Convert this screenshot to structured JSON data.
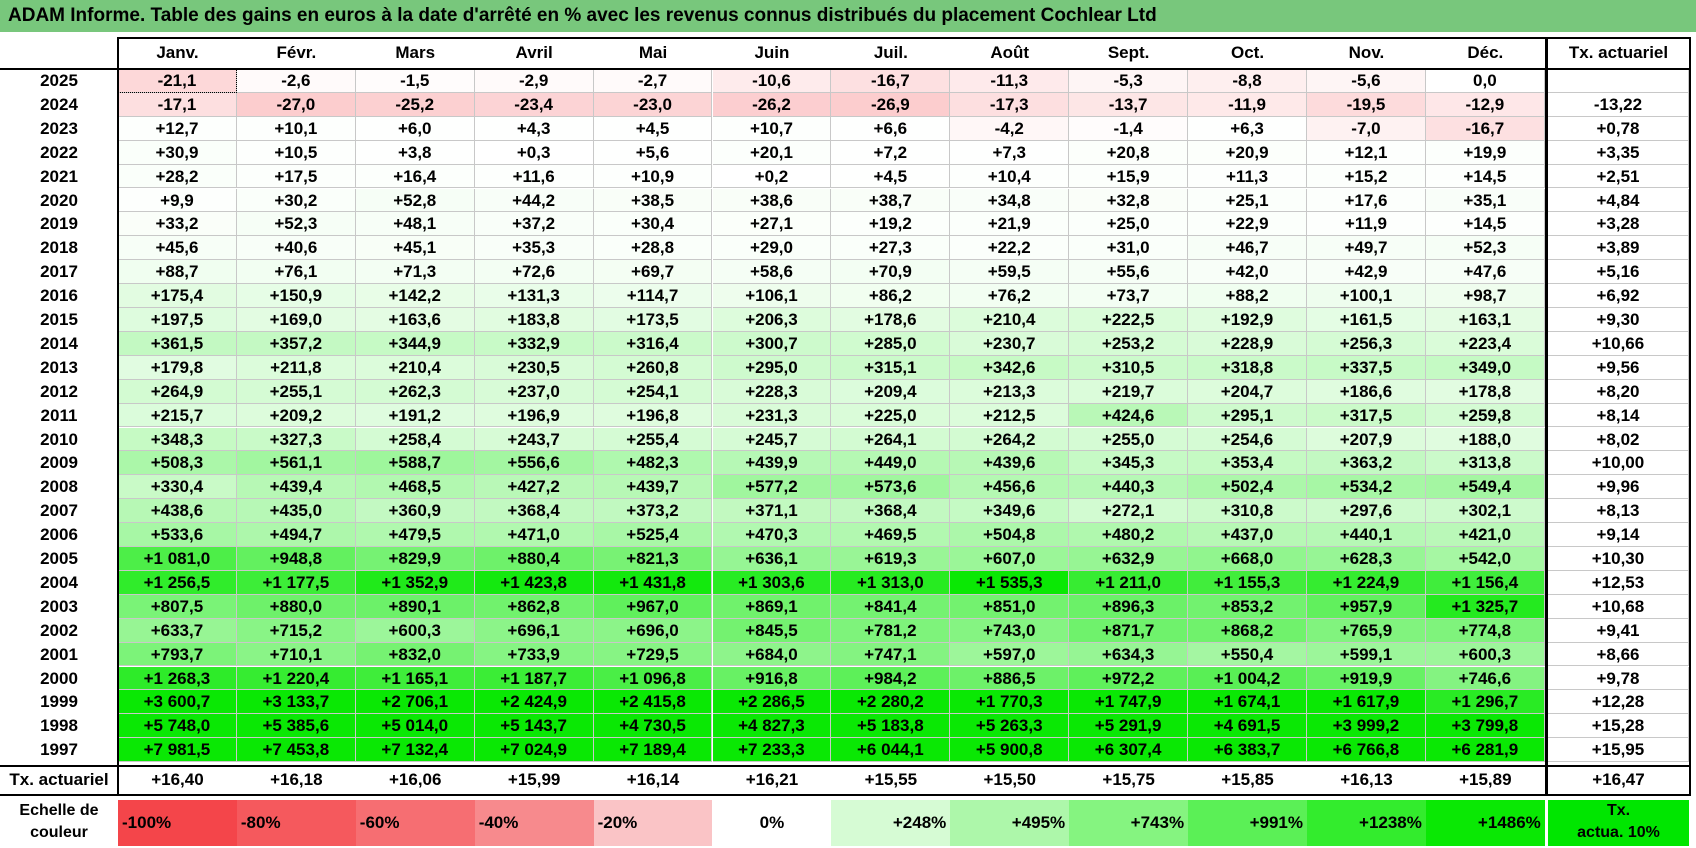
{
  "title": "ADAM Informe. Table des gains en euros à la date d'arrêté en % avec les revenus connus distribués du placement Cochlear Ltd",
  "months": [
    "Janv.",
    "Févr.",
    "Mars",
    "Avril",
    "Mai",
    "Juin",
    "Juil.",
    "Août",
    "Sept.",
    "Oct.",
    "Nov.",
    "Déc."
  ],
  "rate_header": "Tx. actuariel",
  "rows": [
    {
      "year": "2025",
      "values": [
        "-21,1",
        "-2,6",
        "-1,5",
        "-2,9",
        "-2,7",
        "-10,6",
        "-16,7",
        "-11,3",
        "-5,3",
        "-8,8",
        "-5,6",
        "0,0"
      ],
      "rate": ""
    },
    {
      "year": "2024",
      "values": [
        "-17,1",
        "-27,0",
        "-25,2",
        "-23,4",
        "-23,0",
        "-26,2",
        "-26,9",
        "-17,3",
        "-13,7",
        "-11,9",
        "-19,5",
        "-12,9"
      ],
      "rate": "-13,22"
    },
    {
      "year": "2023",
      "values": [
        "+12,7",
        "+10,1",
        "+6,0",
        "+4,3",
        "+4,5",
        "+10,7",
        "+6,6",
        "-4,2",
        "-1,4",
        "+6,3",
        "-7,0",
        "-16,7"
      ],
      "rate": "+0,78"
    },
    {
      "year": "2022",
      "values": [
        "+30,9",
        "+10,5",
        "+3,8",
        "+0,3",
        "+5,6",
        "+20,1",
        "+7,2",
        "+7,3",
        "+20,8",
        "+20,9",
        "+12,1",
        "+19,9"
      ],
      "rate": "+3,35"
    },
    {
      "year": "2021",
      "values": [
        "+28,2",
        "+17,5",
        "+16,4",
        "+11,6",
        "+10,9",
        "+0,2",
        "+4,5",
        "+10,4",
        "+15,9",
        "+11,3",
        "+15,2",
        "+14,5"
      ],
      "rate": "+2,51"
    },
    {
      "year": "2020",
      "values": [
        "+9,9",
        "+30,2",
        "+52,8",
        "+44,2",
        "+38,5",
        "+38,6",
        "+38,7",
        "+34,8",
        "+32,8",
        "+25,1",
        "+17,6",
        "+35,1"
      ],
      "rate": "+4,84"
    },
    {
      "year": "2019",
      "values": [
        "+33,2",
        "+52,3",
        "+48,1",
        "+37,2",
        "+30,4",
        "+27,1",
        "+19,2",
        "+21,9",
        "+25,0",
        "+22,9",
        "+11,9",
        "+14,5"
      ],
      "rate": "+3,28"
    },
    {
      "year": "2018",
      "values": [
        "+45,6",
        "+40,6",
        "+45,1",
        "+35,3",
        "+28,8",
        "+29,0",
        "+27,3",
        "+22,2",
        "+31,0",
        "+46,7",
        "+49,7",
        "+52,3"
      ],
      "rate": "+3,89"
    },
    {
      "year": "2017",
      "values": [
        "+88,7",
        "+76,1",
        "+71,3",
        "+72,6",
        "+69,7",
        "+58,6",
        "+70,9",
        "+59,5",
        "+55,6",
        "+42,0",
        "+42,9",
        "+47,6"
      ],
      "rate": "+5,16"
    },
    {
      "year": "2016",
      "values": [
        "+175,4",
        "+150,9",
        "+142,2",
        "+131,3",
        "+114,7",
        "+106,1",
        "+86,2",
        "+76,2",
        "+73,7",
        "+88,2",
        "+100,1",
        "+98,7"
      ],
      "rate": "+6,92"
    },
    {
      "year": "2015",
      "values": [
        "+197,5",
        "+169,0",
        "+163,6",
        "+183,8",
        "+173,5",
        "+206,3",
        "+178,6",
        "+210,4",
        "+222,5",
        "+192,9",
        "+161,5",
        "+163,1"
      ],
      "rate": "+9,30"
    },
    {
      "year": "2014",
      "values": [
        "+361,5",
        "+357,2",
        "+344,9",
        "+332,9",
        "+316,4",
        "+300,7",
        "+285,0",
        "+230,7",
        "+253,2",
        "+228,9",
        "+256,3",
        "+223,4"
      ],
      "rate": "+10,66"
    },
    {
      "year": "2013",
      "values": [
        "+179,8",
        "+211,8",
        "+210,4",
        "+230,5",
        "+260,8",
        "+295,0",
        "+315,1",
        "+342,6",
        "+310,5",
        "+318,8",
        "+337,5",
        "+349,0"
      ],
      "rate": "+9,56"
    },
    {
      "year": "2012",
      "values": [
        "+264,9",
        "+255,1",
        "+262,3",
        "+237,0",
        "+254,1",
        "+228,3",
        "+209,4",
        "+213,3",
        "+219,7",
        "+204,7",
        "+186,6",
        "+178,8"
      ],
      "rate": "+8,20"
    },
    {
      "year": "2011",
      "values": [
        "+215,7",
        "+209,2",
        "+191,2",
        "+196,9",
        "+196,8",
        "+231,3",
        "+225,0",
        "+212,5",
        "+424,6",
        "+295,1",
        "+317,5",
        "+259,8"
      ],
      "rate": "+8,14"
    },
    {
      "year": "2010",
      "values": [
        "+348,3",
        "+327,3",
        "+258,4",
        "+243,7",
        "+255,4",
        "+245,7",
        "+264,1",
        "+264,2",
        "+255,0",
        "+254,6",
        "+207,9",
        "+188,0"
      ],
      "rate": "+8,02"
    },
    {
      "year": "2009",
      "values": [
        "+508,3",
        "+561,1",
        "+588,7",
        "+556,6",
        "+482,3",
        "+439,9",
        "+449,0",
        "+439,6",
        "+345,3",
        "+353,4",
        "+363,2",
        "+313,8"
      ],
      "rate": "+10,00"
    },
    {
      "year": "2008",
      "values": [
        "+330,4",
        "+439,4",
        "+468,5",
        "+427,2",
        "+439,7",
        "+577,2",
        "+573,6",
        "+456,6",
        "+440,3",
        "+502,4",
        "+534,2",
        "+549,4"
      ],
      "rate": "+9,96"
    },
    {
      "year": "2007",
      "values": [
        "+438,6",
        "+435,0",
        "+360,9",
        "+368,4",
        "+373,2",
        "+371,1",
        "+368,4",
        "+349,6",
        "+272,1",
        "+310,8",
        "+297,6",
        "+302,1"
      ],
      "rate": "+8,13"
    },
    {
      "year": "2006",
      "values": [
        "+533,6",
        "+494,7",
        "+479,5",
        "+471,0",
        "+525,4",
        "+470,3",
        "+469,5",
        "+504,8",
        "+480,2",
        "+437,0",
        "+440,1",
        "+421,0"
      ],
      "rate": "+9,14"
    },
    {
      "year": "2005",
      "values": [
        "+1 081,0",
        "+948,8",
        "+829,9",
        "+880,4",
        "+821,3",
        "+636,1",
        "+619,3",
        "+607,0",
        "+632,9",
        "+668,0",
        "+628,3",
        "+542,0"
      ],
      "rate": "+10,30"
    },
    {
      "year": "2004",
      "values": [
        "+1 256,5",
        "+1 177,5",
        "+1 352,9",
        "+1 423,8",
        "+1 431,8",
        "+1 303,6",
        "+1 313,0",
        "+1 535,3",
        "+1 211,0",
        "+1 155,3",
        "+1 224,9",
        "+1 156,4"
      ],
      "rate": "+12,53"
    },
    {
      "year": "2003",
      "values": [
        "+807,5",
        "+880,0",
        "+890,1",
        "+862,8",
        "+967,0",
        "+869,1",
        "+841,4",
        "+851,0",
        "+896,3",
        "+853,2",
        "+957,9",
        "+1 325,7"
      ],
      "rate": "+10,68"
    },
    {
      "year": "2002",
      "values": [
        "+633,7",
        "+715,2",
        "+600,3",
        "+696,1",
        "+696,0",
        "+845,5",
        "+781,2",
        "+743,0",
        "+871,7",
        "+868,2",
        "+765,9",
        "+774,8"
      ],
      "rate": "+9,41"
    },
    {
      "year": "2001",
      "values": [
        "+793,7",
        "+710,1",
        "+832,0",
        "+733,9",
        "+729,5",
        "+684,0",
        "+747,1",
        "+597,0",
        "+634,3",
        "+550,4",
        "+599,1",
        "+600,3"
      ],
      "rate": "+8,66"
    },
    {
      "year": "2000",
      "values": [
        "+1 268,3",
        "+1 220,4",
        "+1 165,1",
        "+1 187,7",
        "+1 096,8",
        "+916,8",
        "+984,2",
        "+886,5",
        "+972,2",
        "+1 004,2",
        "+919,9",
        "+746,6"
      ],
      "rate": "+9,78"
    },
    {
      "year": "1999",
      "values": [
        "+3 600,7",
        "+3 133,7",
        "+2 706,1",
        "+2 424,9",
        "+2 415,8",
        "+2 286,5",
        "+2 280,2",
        "+1 770,3",
        "+1 747,9",
        "+1 674,1",
        "+1 617,9",
        "+1 296,7"
      ],
      "rate": "+12,28"
    },
    {
      "year": "1998",
      "values": [
        "+5 748,0",
        "+5 385,6",
        "+5 014,0",
        "+5 143,7",
        "+4 730,5",
        "+4 827,3",
        "+5 183,8",
        "+5 263,3",
        "+5 291,9",
        "+4 691,5",
        "+3 999,2",
        "+3 799,8"
      ],
      "rate": "+15,28"
    },
    {
      "year": "1997",
      "values": [
        "+7 981,5",
        "+7 453,8",
        "+7 132,4",
        "+7 024,9",
        "+7 189,4",
        "+7 233,3",
        "+6 044,1",
        "+5 900,8",
        "+6 307,4",
        "+6 383,7",
        "+6 766,8",
        "+6 281,9"
      ],
      "rate": "+15,95"
    }
  ],
  "footer": {
    "label": "Tx. actuariel",
    "values": [
      "+16,40",
      "+16,18",
      "+16,06",
      "+15,99",
      "+16,14",
      "+16,21",
      "+15,55",
      "+15,50",
      "+15,75",
      "+15,85",
      "+16,13",
      "+15,89"
    ],
    "overall": "+16,47"
  },
  "scale": {
    "label_line1": "Echelle de",
    "label_line2": "couleur",
    "items": [
      {
        "label": "-100%",
        "color": "#f4454a"
      },
      {
        "label": "-80%",
        "color": "#f5595d"
      },
      {
        "label": "-60%",
        "color": "#f66e72"
      },
      {
        "label": "-40%",
        "color": "#f78a8d"
      },
      {
        "label": "-20%",
        "color": "#fac4c6"
      },
      {
        "label": "0%",
        "color": "#ffffff"
      },
      {
        "label": "+248%",
        "color": "#d6fbd4"
      },
      {
        "label": "+495%",
        "color": "#adf7aa"
      },
      {
        "label": "+743%",
        "color": "#85f480"
      },
      {
        "label": "+991%",
        "color": "#5bf056"
      },
      {
        "label": "+1238%",
        "color": "#33ec2d"
      },
      {
        "label": "+1486%",
        "color": "#0ae804"
      }
    ],
    "rate_line1": "Tx.",
    "rate_line2": "actua. 10%",
    "rate_color": "#00e600"
  },
  "colors": {
    "title_bg": "#78c77c",
    "neg_full": "#f4454a",
    "pos_full": "#0ae804"
  }
}
